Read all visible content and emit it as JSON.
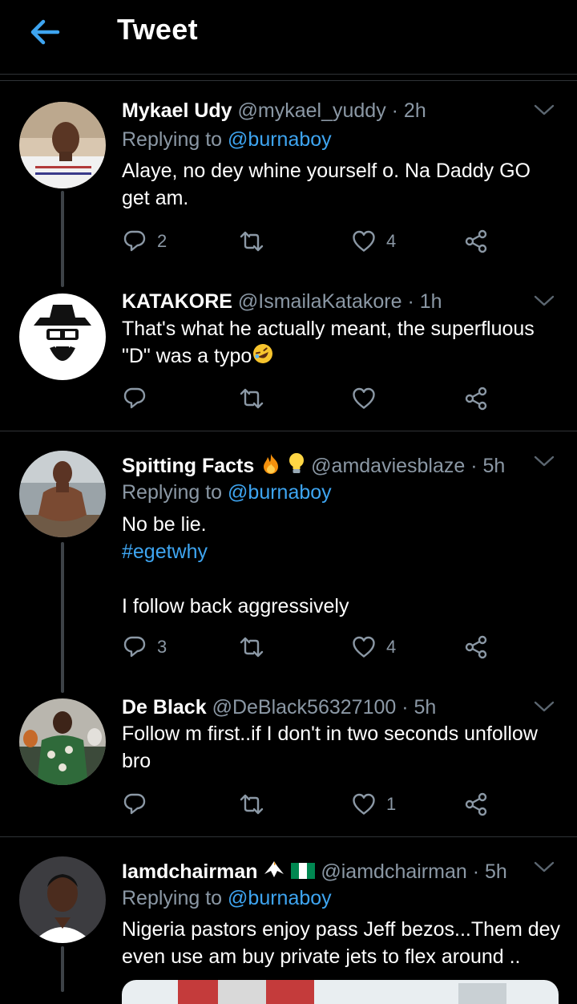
{
  "header": {
    "title": "Tweet"
  },
  "tweets": [
    {
      "name": "Mykael Udy",
      "handle": "@mykael_yuddy",
      "time": "· 2h",
      "replying_prefix": "Replying to",
      "replying_to": "@burnaboy",
      "text": "Alaye, no dey whine yourself o. Na Daddy GO get am.",
      "replies": "2",
      "likes": "4"
    },
    {
      "name": "KATAKORE",
      "handle": "@IsmailaKatakore",
      "time": "· 1h",
      "text": "That's what he actually meant, the superfluous \"D\" was a typo",
      "replies": "",
      "likes": ""
    },
    {
      "name": "Spitting Facts",
      "handle": "@amdaviesblaze",
      "time": "· 5h",
      "replying_prefix": "Replying to",
      "replying_to": "@burnaboy",
      "line1": "No be lie.",
      "hashtag": "#egetwhy",
      "line3": "I follow back aggressively",
      "replies": "3",
      "likes": "4"
    },
    {
      "name": "De Black",
      "handle": "@DeBlack56327100",
      "time": "· 5h",
      "text": "Follow m first..if I don't in two seconds unfollow bro",
      "replies": "",
      "likes": "1"
    },
    {
      "name": "Iamdchairman",
      "handle": "@iamdchairman",
      "time": "· 5h",
      "replying_prefix": "Replying to",
      "replying_to": "@burnaboy",
      "text": "Nigeria pastors enjoy pass Jeff bezos...Them dey even use am buy private jets to flex around .."
    }
  ],
  "colors": {
    "accent": "#3ea5f1",
    "muted": "#8b98a5",
    "divider": "#2f3336",
    "background": "#000000"
  },
  "icons": [
    "back-arrow-icon",
    "chevron-down-icon",
    "reply-icon",
    "retweet-icon",
    "like-icon",
    "share-icon"
  ]
}
